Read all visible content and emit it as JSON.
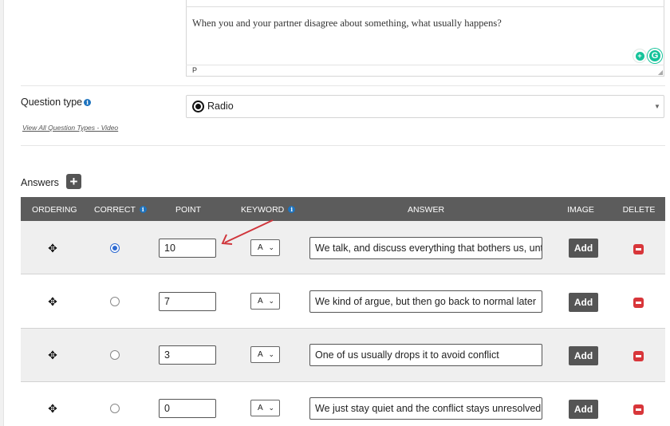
{
  "editor": {
    "content": "When you and your partner disagree about something, what usually happens?",
    "path": "P"
  },
  "question_type": {
    "label": "Question type",
    "selected": "Radio",
    "video_link": "View All Question Types - Video"
  },
  "answers": {
    "label": "Answers",
    "columns": [
      "ORDERING",
      "CORRECT",
      "POINT",
      "KEYWORD",
      "ANSWER",
      "IMAGE",
      "DELETE"
    ],
    "rows": [
      {
        "correct": true,
        "point": "10",
        "keyword": "A",
        "answer": "We talk, and discuss everything that bothers us, until",
        "image_label": "Add"
      },
      {
        "correct": false,
        "point": "7",
        "keyword": "A",
        "answer": "We kind of argue, but then go back to normal later",
        "image_label": "Add"
      },
      {
        "correct": false,
        "point": "3",
        "keyword": "A",
        "answer": "One of us usually drops it to avoid conflict",
        "image_label": "Add"
      },
      {
        "correct": false,
        "point": "0",
        "keyword": "A",
        "answer": "We just stay quiet and the conflict stays unresolved",
        "image_label": "Add"
      }
    ]
  },
  "colors": {
    "header_bg": "#5c5c5c",
    "arrow": "#d0353b",
    "delete": "#d8363a",
    "grammarly": "#15c39a"
  },
  "icons": {
    "info": "info-icon",
    "move": "move-icon",
    "delete": "minus-square-icon",
    "add": "plus-square-icon"
  }
}
